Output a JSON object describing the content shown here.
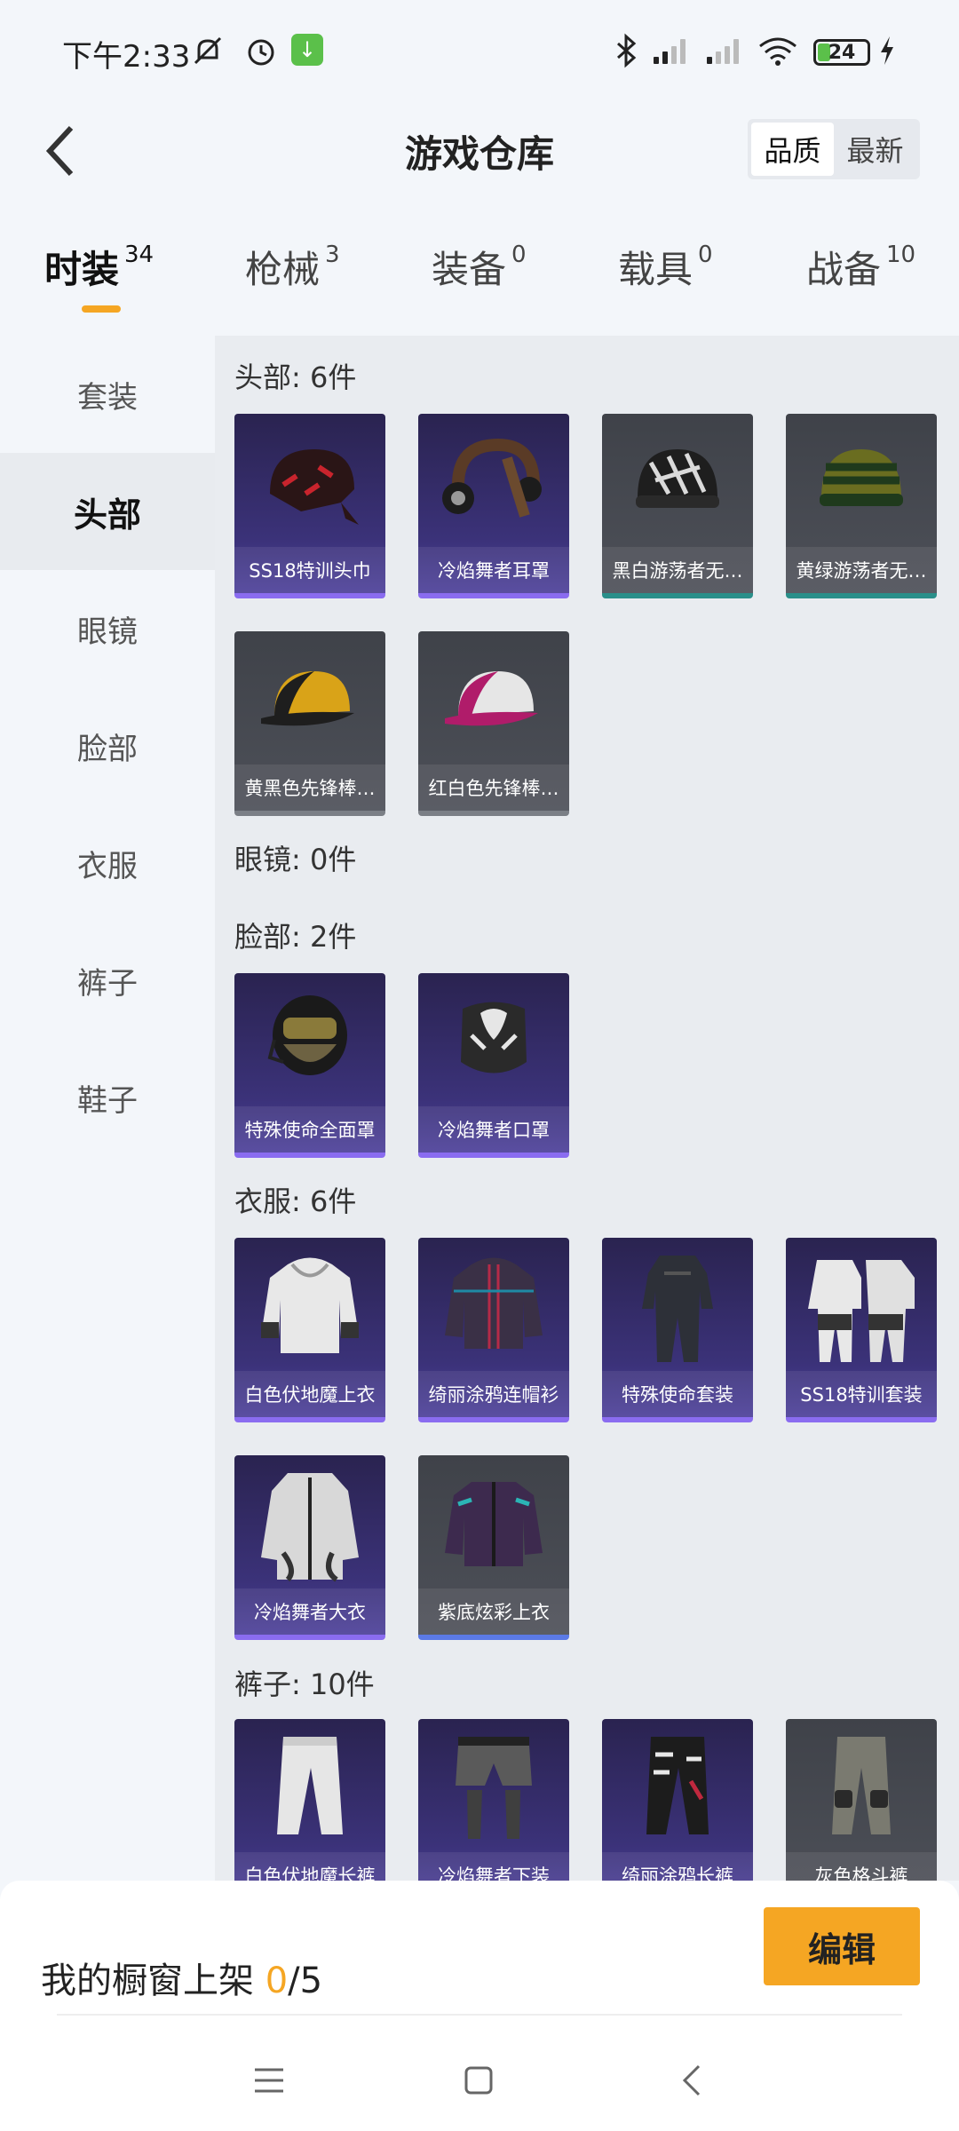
{
  "status_bar": {
    "time": "下午2:33",
    "battery": "24",
    "battery_level": 0.24,
    "icons": [
      "bell-off-icon",
      "alarm-icon",
      "download-badge-icon",
      "bluetooth-icon",
      "signal-hd-icon",
      "signal-icon",
      "wifi-icon",
      "battery-icon",
      "charging-icon"
    ]
  },
  "header": {
    "title": "游戏仓库",
    "sort_options": [
      "品质",
      "最新"
    ],
    "sort_selected": "品质"
  },
  "tabs": [
    {
      "label": "时装",
      "count": "34",
      "active": true
    },
    {
      "label": "枪械",
      "count": "3",
      "active": false
    },
    {
      "label": "装备",
      "count": "0",
      "active": false
    },
    {
      "label": "载具",
      "count": "0",
      "active": false
    },
    {
      "label": "战备",
      "count": "10",
      "active": false
    }
  ],
  "sidebar": {
    "items": [
      "套装",
      "头部",
      "眼镜",
      "脸部",
      "衣服",
      "裤子",
      "鞋子"
    ],
    "active": "头部"
  },
  "sections": [
    {
      "title": "头部: 6件",
      "items": [
        {
          "name": "SS18特训头巾",
          "quality": "purple",
          "icon": "bandana-icon"
        },
        {
          "name": "冷焰舞者耳罩",
          "quality": "purple",
          "icon": "earmuffs-icon"
        },
        {
          "name": "黑白游荡者无…",
          "quality": "gray-teal",
          "icon": "beanie-icon"
        },
        {
          "name": "黄绿游荡者无…",
          "quality": "gray-teal",
          "icon": "beanie-icon"
        },
        {
          "name": "黄黑色先锋棒…",
          "quality": "gray",
          "icon": "cap-icon"
        },
        {
          "name": "红白色先锋棒…",
          "quality": "gray",
          "icon": "cap-icon"
        }
      ]
    },
    {
      "title": "眼镜: 0件",
      "items": []
    },
    {
      "title": "脸部: 2件",
      "items": [
        {
          "name": "特殊使命全面罩",
          "quality": "purple",
          "icon": "helmet-mask-icon"
        },
        {
          "name": "冷焰舞者口罩",
          "quality": "purple",
          "icon": "face-mask-icon"
        }
      ]
    },
    {
      "title": "衣服: 6件",
      "items": [
        {
          "name": "白色伏地魔上衣",
          "quality": "purple",
          "icon": "hoodie-icon"
        },
        {
          "name": "绮丽涂鸦连帽衫",
          "quality": "purple",
          "icon": "hoodie-icon"
        },
        {
          "name": "特殊使命套装",
          "quality": "purple",
          "icon": "suit-icon"
        },
        {
          "name": "SS18特训套装",
          "quality": "purple",
          "icon": "suit-icon"
        },
        {
          "name": "冷焰舞者大衣",
          "quality": "purple",
          "icon": "coat-icon"
        },
        {
          "name": "紫底炫彩上衣",
          "quality": "gray-blue",
          "icon": "jacket-icon"
        }
      ]
    },
    {
      "title": "裤子: 10件",
      "items": [
        {
          "name": "白色伏地魔长裤",
          "quality": "purple",
          "icon": "pants-icon"
        },
        {
          "name": "冷焰舞者下装",
          "quality": "purple",
          "icon": "shorts-icon"
        },
        {
          "name": "绮丽涂鸦长裤",
          "quality": "purple",
          "icon": "pants-icon"
        },
        {
          "name": "灰色格斗裤",
          "quality": "gray",
          "icon": "pants-icon"
        }
      ]
    }
  ],
  "showcase": {
    "label": "我的橱窗上架",
    "current": "0",
    "separator": "/",
    "max": "5",
    "edit_label": "编辑"
  },
  "nav": [
    "menu-icon",
    "home-icon",
    "back-icon"
  ],
  "colors": {
    "accent": "#f5a623",
    "purple_card": "#3b3279",
    "gray_card": "#4d5058",
    "teal_bar": "#2a8f8a",
    "blue_bar": "#5b7ae6"
  }
}
